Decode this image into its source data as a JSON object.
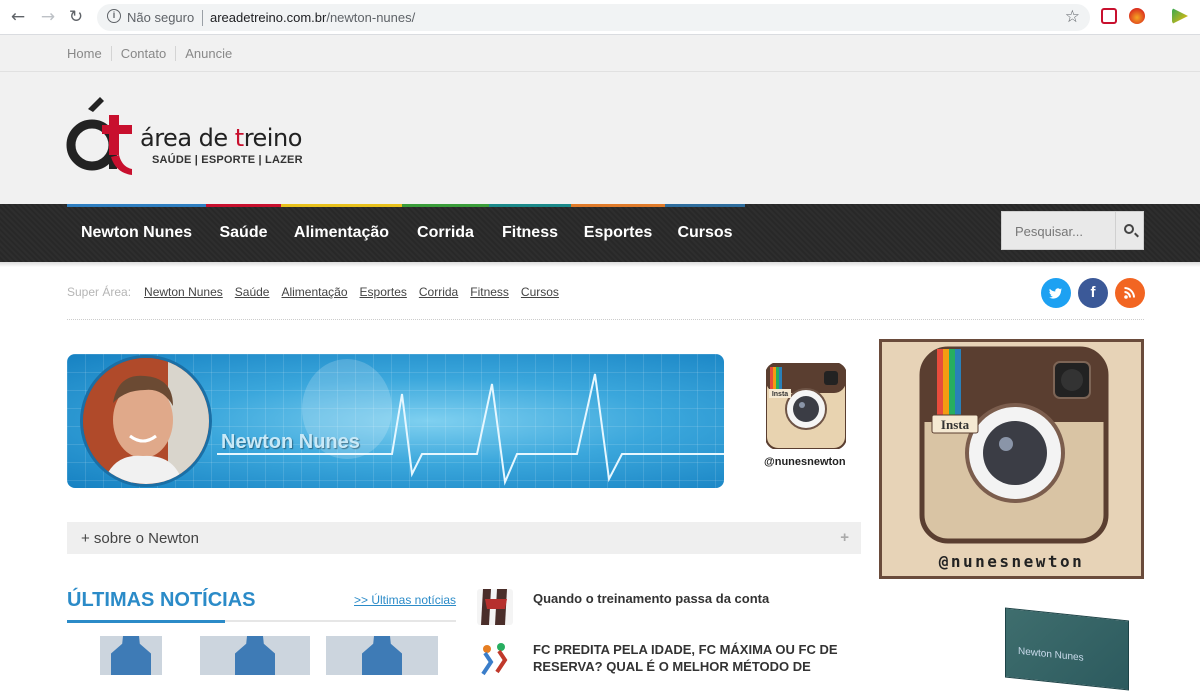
{
  "browser": {
    "security_label": "Não seguro",
    "url_domain": "areadetreino.com.br",
    "url_path": "/newton-nunes/"
  },
  "topbar": {
    "links": [
      "Home",
      "Contato",
      "Anuncie"
    ]
  },
  "logo": {
    "name_prefix": "área de ",
    "name_accent": "t",
    "name_suffix": "reino",
    "tagline": "SAÚDE | ESPORTE | LAZER"
  },
  "nav": {
    "items": [
      {
        "label": "Newton Nunes",
        "color": "#2f7fc1"
      },
      {
        "label": "Saúde",
        "color": "#c8102e"
      },
      {
        "label": "Alimentação",
        "color": "#e8c11c"
      },
      {
        "label": "Corrida",
        "color": "#3a9d3a"
      },
      {
        "label": "Fitness",
        "color": "#1b8a8a"
      },
      {
        "label": "Esportes",
        "color": "#e07b2a"
      },
      {
        "label": "Cursos",
        "color": "#2f6e9e"
      }
    ],
    "search_placeholder": "Pesquisar..."
  },
  "superarea": {
    "label": "Super Área:",
    "links": [
      "Newton Nunes",
      "Saúde",
      "Alimentação",
      "Esportes",
      "Corrida",
      "Fitness",
      "Cursos"
    ]
  },
  "social": {
    "twitter_color": "#1da1f2",
    "facebook_color": "#3b5998",
    "rss_color": "#f26522"
  },
  "banner": {
    "name": "Newton Nunes"
  },
  "instagram": {
    "badge": "Insta",
    "handle": "@nunesnewton"
  },
  "sobre": {
    "label": "+ sobre o Newton"
  },
  "latest": {
    "title": "ÚLTIMAS NOTÍCIAS",
    "more_link": ">> Últimas notícias",
    "items": [
      {
        "title": "Quando o treinamento passa da conta"
      },
      {
        "title": "FC PREDITA PELA IDADE, FC MÁXIMA OU FC DE RESERVA? QUAL É O MELHOR MÉTODO DE"
      }
    ]
  },
  "book": {
    "title": "Newton Nunes"
  }
}
